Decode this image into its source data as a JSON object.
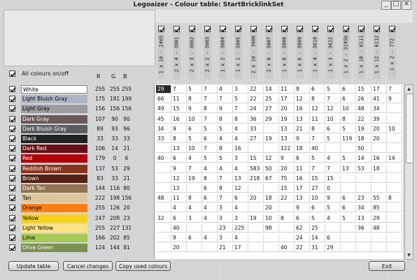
{
  "window": {
    "title": "Legoaizer - Colour table: StartBricklinkSet",
    "min_icon": "minimize-icon",
    "max_icon": "maximize-icon",
    "close_icon": "close-icon"
  },
  "controls": {
    "all_colours_label": "All colours on/off",
    "r_label": "R",
    "g_label": "G",
    "b_label": "B"
  },
  "columns": [
    "1 x 16 - 2465",
    "2 x 4 - 3001",
    "2 x 3 - 3002",
    "2 x 2 - 3003",
    "1 x 2 - 3004",
    "1 x 1 - 3005",
    "2 x 10 - 3006",
    "2 x 8 - 3007",
    "1 x 8 - 3008",
    "1 x 6 - 3009",
    "1 x 4 - 3010",
    "1 x 3 - 3622",
    "1 x 2 - 3245b",
    "1 x 10 - 6111",
    "1 x 12 - 6112",
    "1 x 2 - 772"
  ],
  "colors": [
    {
      "name": "White",
      "r": 255,
      "g": 255,
      "b": 255,
      "swatch": "#ffffff",
      "text": "#000000"
    },
    {
      "name": "Light Bluish Gray",
      "r": 175,
      "g": 181,
      "b": 199,
      "swatch": "#afb5c7",
      "text": "#000000"
    },
    {
      "name": "Light Gray",
      "r": 156,
      "g": 156,
      "b": 156,
      "swatch": "#9c9c9c",
      "text": "#000000"
    },
    {
      "name": "Dark Gray",
      "r": 107,
      "g": 90,
      "b": 90,
      "swatch": "#6b5a5a",
      "text": "#ffffff"
    },
    {
      "name": "Dark Bluish Gray",
      "r": 89,
      "g": 93,
      "b": 96,
      "swatch": "#595d60",
      "text": "#ffffff"
    },
    {
      "name": "Black",
      "r": 33,
      "g": 33,
      "b": 33,
      "swatch": "#212121",
      "text": "#ffffff"
    },
    {
      "name": "Dark Red",
      "r": 106,
      "g": 14,
      "b": 21,
      "swatch": "#6a0e15",
      "text": "#ffffff"
    },
    {
      "name": "Red",
      "r": 179,
      "g": 0,
      "b": 6,
      "swatch": "#b30006",
      "text": "#ffffff"
    },
    {
      "name": "Reddish Brown",
      "r": 137,
      "g": 53,
      "b": 29,
      "swatch": "#89351d",
      "text": "#ffffff"
    },
    {
      "name": "Brown",
      "r": 83,
      "g": 33,
      "b": 21,
      "swatch": "#532115",
      "text": "#ffffff"
    },
    {
      "name": "Dark Tan",
      "r": 144,
      "g": 116,
      "b": 80,
      "swatch": "#907450",
      "text": "#ffffff"
    },
    {
      "name": "Tan",
      "r": 222,
      "g": 198,
      "b": 156,
      "swatch": "#dec69c",
      "text": "#000000"
    },
    {
      "name": "Orange",
      "r": 255,
      "g": 126,
      "b": 20,
      "swatch": "#ff7e14",
      "text": "#000000"
    },
    {
      "name": "Yellow",
      "r": 247,
      "g": 209,
      "b": 23,
      "swatch": "#f7d117",
      "text": "#000000"
    },
    {
      "name": "Light Yellow",
      "r": 255,
      "g": 227,
      "b": 131,
      "swatch": "#ffe383",
      "text": "#000000"
    },
    {
      "name": "Lime",
      "r": 166,
      "g": 202,
      "b": 85,
      "swatch": "#a6ca55",
      "text": "#000000"
    },
    {
      "name": "Olive Green",
      "r": 124,
      "g": 144,
      "b": 81,
      "swatch": "#7c9051",
      "text": "#ffffff"
    }
  ],
  "table": [
    [
      "29",
      "7",
      "5",
      "7",
      "4",
      "3",
      "22",
      "14",
      "11",
      "8",
      "6",
      "5",
      "6",
      "15",
      "17",
      "7"
    ],
    [
      "66",
      "11",
      "8",
      "7",
      "7",
      "5",
      "22",
      "25",
      "17",
      "12",
      "8",
      "7",
      "6",
      "26",
      "41",
      "9"
    ],
    [
      "49",
      "15",
      "9",
      "8",
      "9",
      "7",
      "24",
      "27",
      "20",
      "16",
      "12",
      "12",
      "10",
      "48",
      "34",
      ""
    ],
    [
      "45",
      "16",
      "10",
      "7",
      "8",
      "8",
      "36",
      "29",
      "19",
      "13",
      "11",
      "10",
      "8",
      "22",
      "39",
      ""
    ],
    [
      "34",
      "9",
      "6",
      "5",
      "5",
      "4",
      "33",
      "",
      "13",
      "21",
      "8",
      "6",
      "5",
      "19",
      "20",
      "10"
    ],
    [
      "33",
      "8",
      "5",
      "6",
      "4",
      "4",
      "27",
      "19",
      "13",
      "9",
      "7",
      "5",
      "119",
      "18",
      "20",
      ""
    ],
    [
      "",
      "13",
      "10",
      "7",
      "8",
      "16",
      "",
      "",
      "122",
      "18",
      "40",
      "",
      "",
      "50",
      "",
      ""
    ],
    [
      "40",
      "6",
      "4",
      "5",
      "5",
      "3",
      "15",
      "12",
      "9",
      "6",
      "5",
      "4",
      "5",
      "14",
      "16",
      "14"
    ],
    [
      "",
      "9",
      "7",
      "4",
      "4",
      "4",
      "583",
      "50",
      "20",
      "11",
      "7",
      "7",
      "13",
      "53",
      "18",
      ""
    ],
    [
      "",
      "12",
      "19",
      "8",
      "7",
      "13",
      "218",
      "67",
      "75",
      "16",
      "15",
      "15",
      "",
      "",
      "",
      ""
    ],
    [
      "",
      "13",
      "",
      "6",
      "8",
      "12",
      "",
      "",
      "15",
      "17",
      "27",
      "0",
      "",
      "",
      "",
      ""
    ],
    [
      "48",
      "11",
      "8",
      "6",
      "7",
      "6",
      "20",
      "18",
      "22",
      "13",
      "10",
      "9",
      "6",
      "23",
      "55",
      "8"
    ],
    [
      "",
      "4",
      "4",
      "4",
      "3",
      "4",
      "",
      "20",
      "",
      "9",
      "6",
      "5",
      "6",
      "34",
      "85",
      ""
    ],
    [
      "32",
      "6",
      "3",
      "4",
      "3",
      "3",
      "19",
      "10",
      "8",
      "6",
      "5",
      "4",
      "5",
      "13",
      "29",
      ""
    ],
    [
      "",
      "40",
      "",
      "",
      "23",
      "225",
      "",
      "98",
      "",
      "62",
      "25",
      "",
      "",
      "36",
      "48",
      ""
    ],
    [
      "",
      "9",
      "6",
      "4",
      "3",
      "4",
      "",
      "",
      "",
      "24",
      "14",
      "6",
      "",
      "",
      "",
      ""
    ],
    [
      "",
      "20",
      "",
      "",
      "21",
      "17",
      "",
      "",
      "40",
      "22",
      "31",
      "29",
      "",
      "",
      "",
      ""
    ]
  ],
  "buttons": {
    "update": "Update table",
    "cancel": "Cancel changes",
    "copy": "Copy used colours",
    "exit": "Exit"
  }
}
